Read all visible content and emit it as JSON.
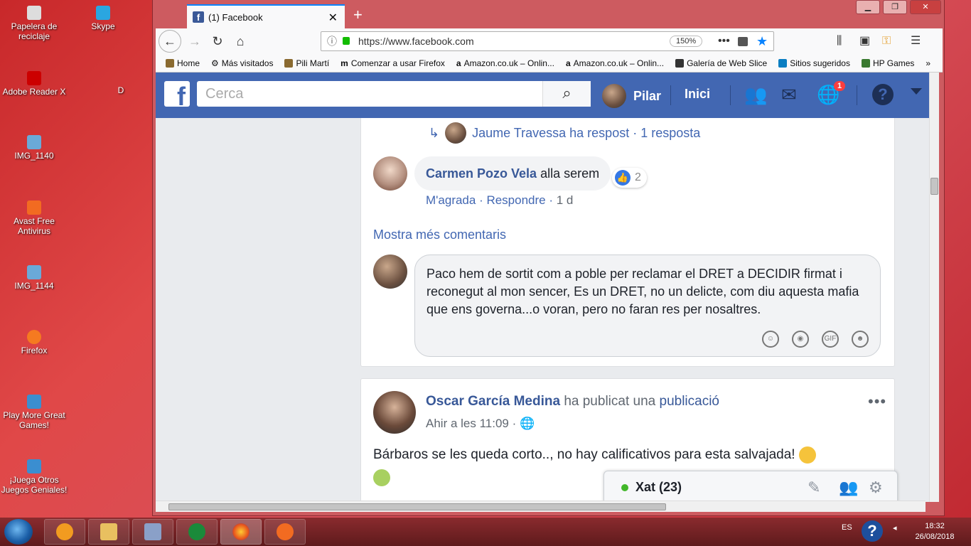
{
  "desktop": {
    "icons": [
      {
        "label": "Papelera de reciclaje"
      },
      {
        "label": "Skype"
      },
      {
        "label": "Adobe Reader X"
      },
      {
        "label": "IMG_1140"
      },
      {
        "label": "Avast Free Antivirus"
      },
      {
        "label": "IMG_1144"
      },
      {
        "label": "Firefox"
      },
      {
        "label": "Play More Great Games!"
      },
      {
        "label": "¡Juega Otros Juegos Geniales!"
      }
    ],
    "cut_label": "D"
  },
  "browser": {
    "tab_title": "(1) Facebook",
    "url": "https://www.facebook.com",
    "zoom": "150%",
    "bookmarks": [
      "Home",
      "Más visitados",
      "Pili Martí",
      "Comenzar a usar Firefox",
      "Amazon.co.uk – Onlin...",
      "Amazon.co.uk – Onlin...",
      "Galería de Web Slice",
      "Sitios sugeridos",
      "HP Games"
    ]
  },
  "fb": {
    "search_placeholder": "Cerca",
    "user": "Pilar",
    "home": "Inici",
    "notif_count": "1"
  },
  "comments": {
    "reply_text": "Jaume Travessa ha respost · 1 resposta",
    "author": "Carmen Pozo Vela",
    "text": "alla serem",
    "likes": "2",
    "like_label": "M'agrada",
    "reply_label": "Respondre",
    "age": "1 d",
    "more": "Mostra més comentaris",
    "draft": "Paco hem de sortit com a poble per reclamar el DRET a DECIDIR firmat i reconegut al mon sencer, Es un DRET, no un delicte, com diu aquesta mafia que ens governa...o voran, pero no faran res per nosaltres."
  },
  "post": {
    "author": "Oscar García Medina",
    "action": "ha publicat una",
    "object": "publicació",
    "time": "Ahir a les 11:09 ·",
    "text": "Bárbaros se les queda corto.., no hay calificativos para esta salvajada!"
  },
  "chat": {
    "label": "Xat (23)"
  },
  "taskbar": {
    "lang": "ES",
    "time": "18:32",
    "date": "26/08/2018"
  }
}
